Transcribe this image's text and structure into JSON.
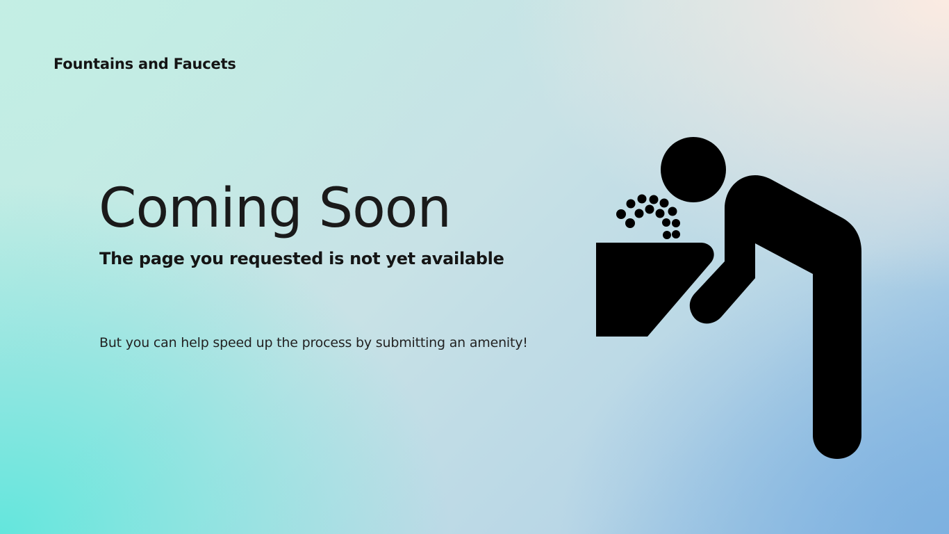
{
  "header": {
    "brand": "Fountains and Faucets"
  },
  "main": {
    "title": "Coming Soon",
    "subtitle": "The page you requested is not yet available",
    "message": "But you can help speed up the process by submitting an amenity!"
  },
  "illustration": {
    "icon": "drinking-fountain-icon",
    "color": "#000000"
  }
}
